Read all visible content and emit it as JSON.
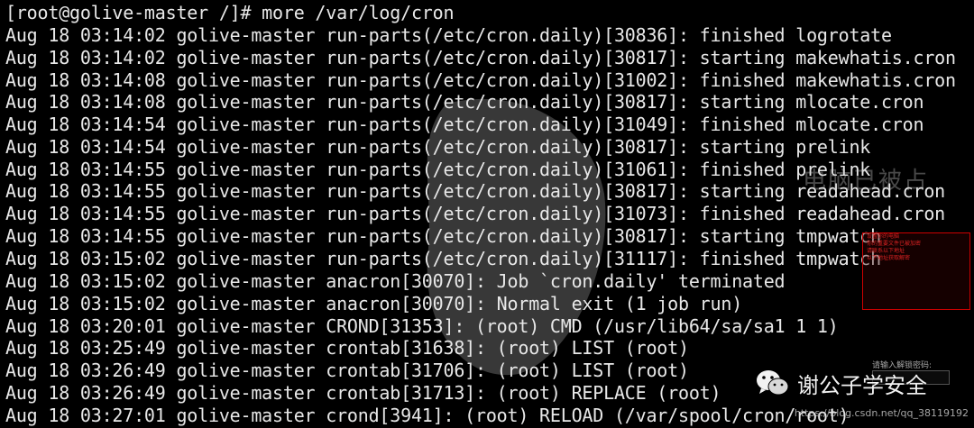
{
  "terminal": {
    "lines": [
      "[root@golive-master /]# more /var/log/cron",
      "Aug 18 03:14:02 golive-master run-parts(/etc/cron.daily)[30836]: finished logrotate",
      "Aug 18 03:14:02 golive-master run-parts(/etc/cron.daily)[30817]: starting makewhatis.cron",
      "Aug 18 03:14:08 golive-master run-parts(/etc/cron.daily)[31002]: finished makewhatis.cron",
      "Aug 18 03:14:08 golive-master run-parts(/etc/cron.daily)[30817]: starting mlocate.cron",
      "Aug 18 03:14:54 golive-master run-parts(/etc/cron.daily)[31049]: finished mlocate.cron",
      "Aug 18 03:14:54 golive-master run-parts(/etc/cron.daily)[30817]: starting prelink",
      "Aug 18 03:14:55 golive-master run-parts(/etc/cron.daily)[31061]: finished prelink",
      "Aug 18 03:14:55 golive-master run-parts(/etc/cron.daily)[30817]: starting readahead.cron",
      "Aug 18 03:14:55 golive-master run-parts(/etc/cron.daily)[31073]: finished readahead.cron",
      "Aug 18 03:14:55 golive-master run-parts(/etc/cron.daily)[30817]: starting tmpwatch",
      "Aug 18 03:15:02 golive-master run-parts(/etc/cron.daily)[31117]: finished tmpwatch",
      "Aug 18 03:15:02 golive-master anacron[30070]: Job `cron.daily' terminated",
      "Aug 18 03:15:02 golive-master anacron[30070]: Normal exit (1 job run)",
      "Aug 18 03:20:01 golive-master CROND[31353]: (root) CMD (/usr/lib64/sa/sa1 1 1)",
      "Aug 18 03:25:49 golive-master crontab[31638]: (root) LIST (root)",
      "Aug 18 03:26:49 golive-master crontab[31706]: (root) LIST (root)",
      "Aug 18 03:26:49 golive-master crontab[31713]: (root) REPLACE (root)",
      "Aug 18 03:27:01 golive-master crond[3941]: (root) RELOAD (/var/spool/cron/root)"
    ]
  },
  "watermark": {
    "overlay_text": "电脑已被占",
    "warning_lines": [
      "设置你的电脑",
      "你的重要文件已被加密",
      "请联系以下地址",
      "以下地址获取解密"
    ],
    "unlock_label": "请输入解锁密码:",
    "brand": "谢公子学安全",
    "brand_icon": "wechat-icon",
    "csdn": "https://blog.csdn.net/qq_38119192"
  },
  "colors": {
    "background": "#000000",
    "text": "#e8e8e8",
    "warning": "#cc0000"
  }
}
